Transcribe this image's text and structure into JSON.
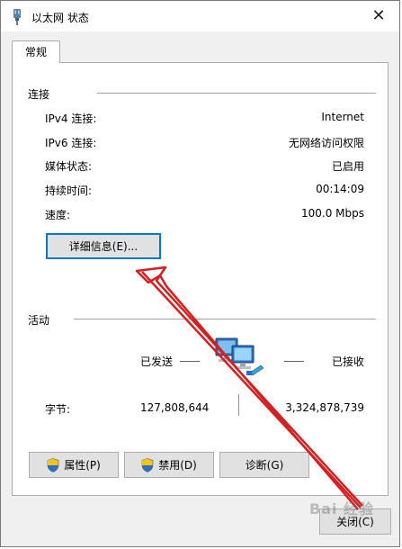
{
  "window": {
    "title": "以太网 状态",
    "close_glyph": "✕"
  },
  "tabs": [
    {
      "label": "常规",
      "selected": true
    }
  ],
  "connection": {
    "group_label": "连接",
    "rows": [
      {
        "label": "IPv4 连接:",
        "value": "Internet"
      },
      {
        "label": "IPv6 连接:",
        "value": "无网络访问权限"
      },
      {
        "label": "媒体状态:",
        "value": "已启用"
      },
      {
        "label": "持续时间:",
        "value": "00:14:09"
      },
      {
        "label": "速度:",
        "value": "100.0 Mbps"
      }
    ],
    "details_button": "详细信息(E)..."
  },
  "activity": {
    "group_label": "活动",
    "sent_label": "已发送",
    "received_label": "已接收",
    "bytes_label": "字节:",
    "bytes_sent": "127,808,644",
    "bytes_received": "3,324,878,739"
  },
  "buttons": {
    "properties": "属性(P)",
    "disable": "禁用(D)",
    "diagnose": "诊断(G)",
    "close": "关闭(C)"
  },
  "watermark": "Bai 经验",
  "colors": {
    "window_bg": "#f0f0f0",
    "panel_bg": "#ffffff",
    "focus_border": "#0078d7",
    "annotation_arrow": "#d42020"
  },
  "icons": {
    "title": "ethernet-plug-icon",
    "network": "network-computers-icon",
    "shield": "uac-shield-icon"
  }
}
